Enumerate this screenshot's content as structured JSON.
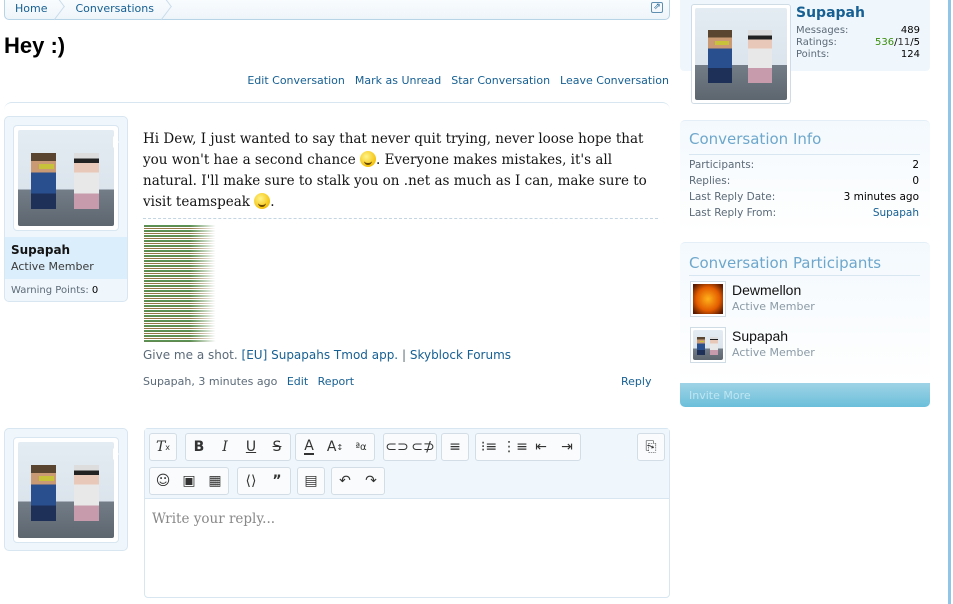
{
  "breadcrumb": {
    "items": [
      {
        "label": "Home"
      },
      {
        "label": "Conversations"
      }
    ],
    "jump_icon": "external-link-icon"
  },
  "conversation": {
    "title": "Hey :)",
    "actions": [
      "Edit Conversation",
      "Mark as Unread",
      "Star Conversation",
      "Leave Conversation"
    ]
  },
  "message": {
    "author": {
      "name": "Supapah",
      "title": "Active Member",
      "warning_label": "Warning Points:",
      "warning_points": "0"
    },
    "text_part1": "Hi Dew, I just wanted to say that never quit trying, never loose hope that you won't hae a second chance ",
    "text_part2": ". Everyone makes mistakes, it's all natural. I'll make sure to stalk you on .net as much as I can, make sure to visit teamspeak ",
    "text_part3": ".",
    "signature": {
      "prefix": "Give me a shot.",
      "link1": "[EU] Supapahs Tmod app.",
      "divider": "|",
      "link2": "Skyblock Forums"
    },
    "meta": {
      "byline": "Supapah, 3 minutes ago",
      "edit": "Edit",
      "report": "Report",
      "reply": "Reply"
    }
  },
  "editor": {
    "placeholder": "Write your reply...",
    "toolbar_icons": [
      "remove-format-icon",
      "bold-icon",
      "italic-icon",
      "underline-icon",
      "strikethrough-icon",
      "text-color-icon",
      "font-size-icon",
      "font-family-icon",
      "link-icon",
      "unlink-icon",
      "align-icon",
      "bullet-list-icon",
      "numbered-list-icon",
      "outdent-icon",
      "indent-icon",
      "switch-mode-icon",
      "smilies-icon",
      "image-icon",
      "media-icon",
      "code-icon",
      "quote-icon",
      "save-draft-icon",
      "undo-icon",
      "redo-icon"
    ]
  },
  "sidebar": {
    "visitor": {
      "name": "Supapah",
      "messages_label": "Messages:",
      "messages": "489",
      "ratings_label": "Ratings:",
      "ratings_pos": "536",
      "ratings_neu": "11",
      "ratings_neg": "5",
      "points_label": "Points:",
      "points": "124"
    },
    "info": {
      "heading": "Conversation Info",
      "participants_label": "Participants:",
      "participants": "2",
      "replies_label": "Replies:",
      "replies": "0",
      "last_reply_date_label": "Last Reply Date:",
      "last_reply_date": "3 minutes ago",
      "last_reply_from_label": "Last Reply From:",
      "last_reply_from": "Supapah"
    },
    "participants": {
      "heading": "Conversation Participants",
      "list": [
        {
          "name": "Dewmellon",
          "role": "Active Member"
        },
        {
          "name": "Supapah",
          "role": "Active Member"
        }
      ],
      "invite": "Invite More"
    }
  },
  "colors": {
    "link": "#176093",
    "heading": "#6ea7cc",
    "rating_positive": "#3a8d0d",
    "rating_negative": "#cc0000"
  }
}
